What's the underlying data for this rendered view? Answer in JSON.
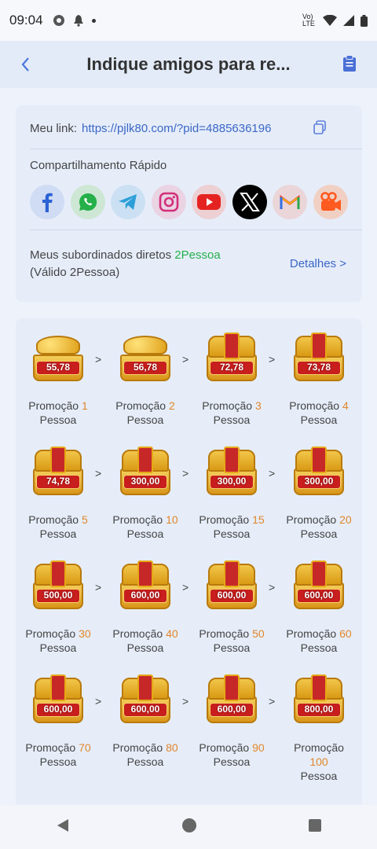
{
  "status_bar": {
    "time": "09:04",
    "network": "Vo) LTE"
  },
  "header": {
    "title": "Indique amigos para re..."
  },
  "link_card": {
    "link_label": "Meu link:",
    "link_url": "https://pjlk80.com/?pid=4885636196",
    "quick_share_label": "Compartilhamento Rápido",
    "social": [
      "facebook-icon",
      "whatsapp-icon",
      "telegram-icon",
      "instagram-icon",
      "youtube-icon",
      "x-icon",
      "gmail-icon",
      "kwai-icon"
    ],
    "subs_prefix": "Meus subordinados diretos",
    "subs_value": "2Pessoa",
    "subs_valid": "(Válido 2Pessoa)",
    "details_label": "Detalhes >"
  },
  "rewards": {
    "prefix": "Promoção",
    "suffix": "Pessoa",
    "tiers": [
      {
        "amount": "55,78",
        "count": "1",
        "style": "gold"
      },
      {
        "amount": "56,78",
        "count": "2",
        "style": "gold"
      },
      {
        "amount": "72,78",
        "count": "3",
        "style": "closed"
      },
      {
        "amount": "73,78",
        "count": "4",
        "style": "closed"
      },
      {
        "amount": "74,78",
        "count": "5",
        "style": "closed"
      },
      {
        "amount": "300,00",
        "count": "10",
        "style": "closed"
      },
      {
        "amount": "300,00",
        "count": "15",
        "style": "closed"
      },
      {
        "amount": "300,00",
        "count": "20",
        "style": "closed"
      },
      {
        "amount": "500,00",
        "count": "30",
        "style": "closed"
      },
      {
        "amount": "600,00",
        "count": "40",
        "style": "closed"
      },
      {
        "amount": "600,00",
        "count": "50",
        "style": "closed"
      },
      {
        "amount": "600,00",
        "count": "60",
        "style": "closed"
      },
      {
        "amount": "600,00",
        "count": "70",
        "style": "closed"
      },
      {
        "amount": "600,00",
        "count": "80",
        "style": "closed"
      },
      {
        "amount": "600,00",
        "count": "90",
        "style": "closed"
      },
      {
        "amount": "800,00",
        "count": "100",
        "style": "closed"
      }
    ],
    "arrow": ">"
  }
}
